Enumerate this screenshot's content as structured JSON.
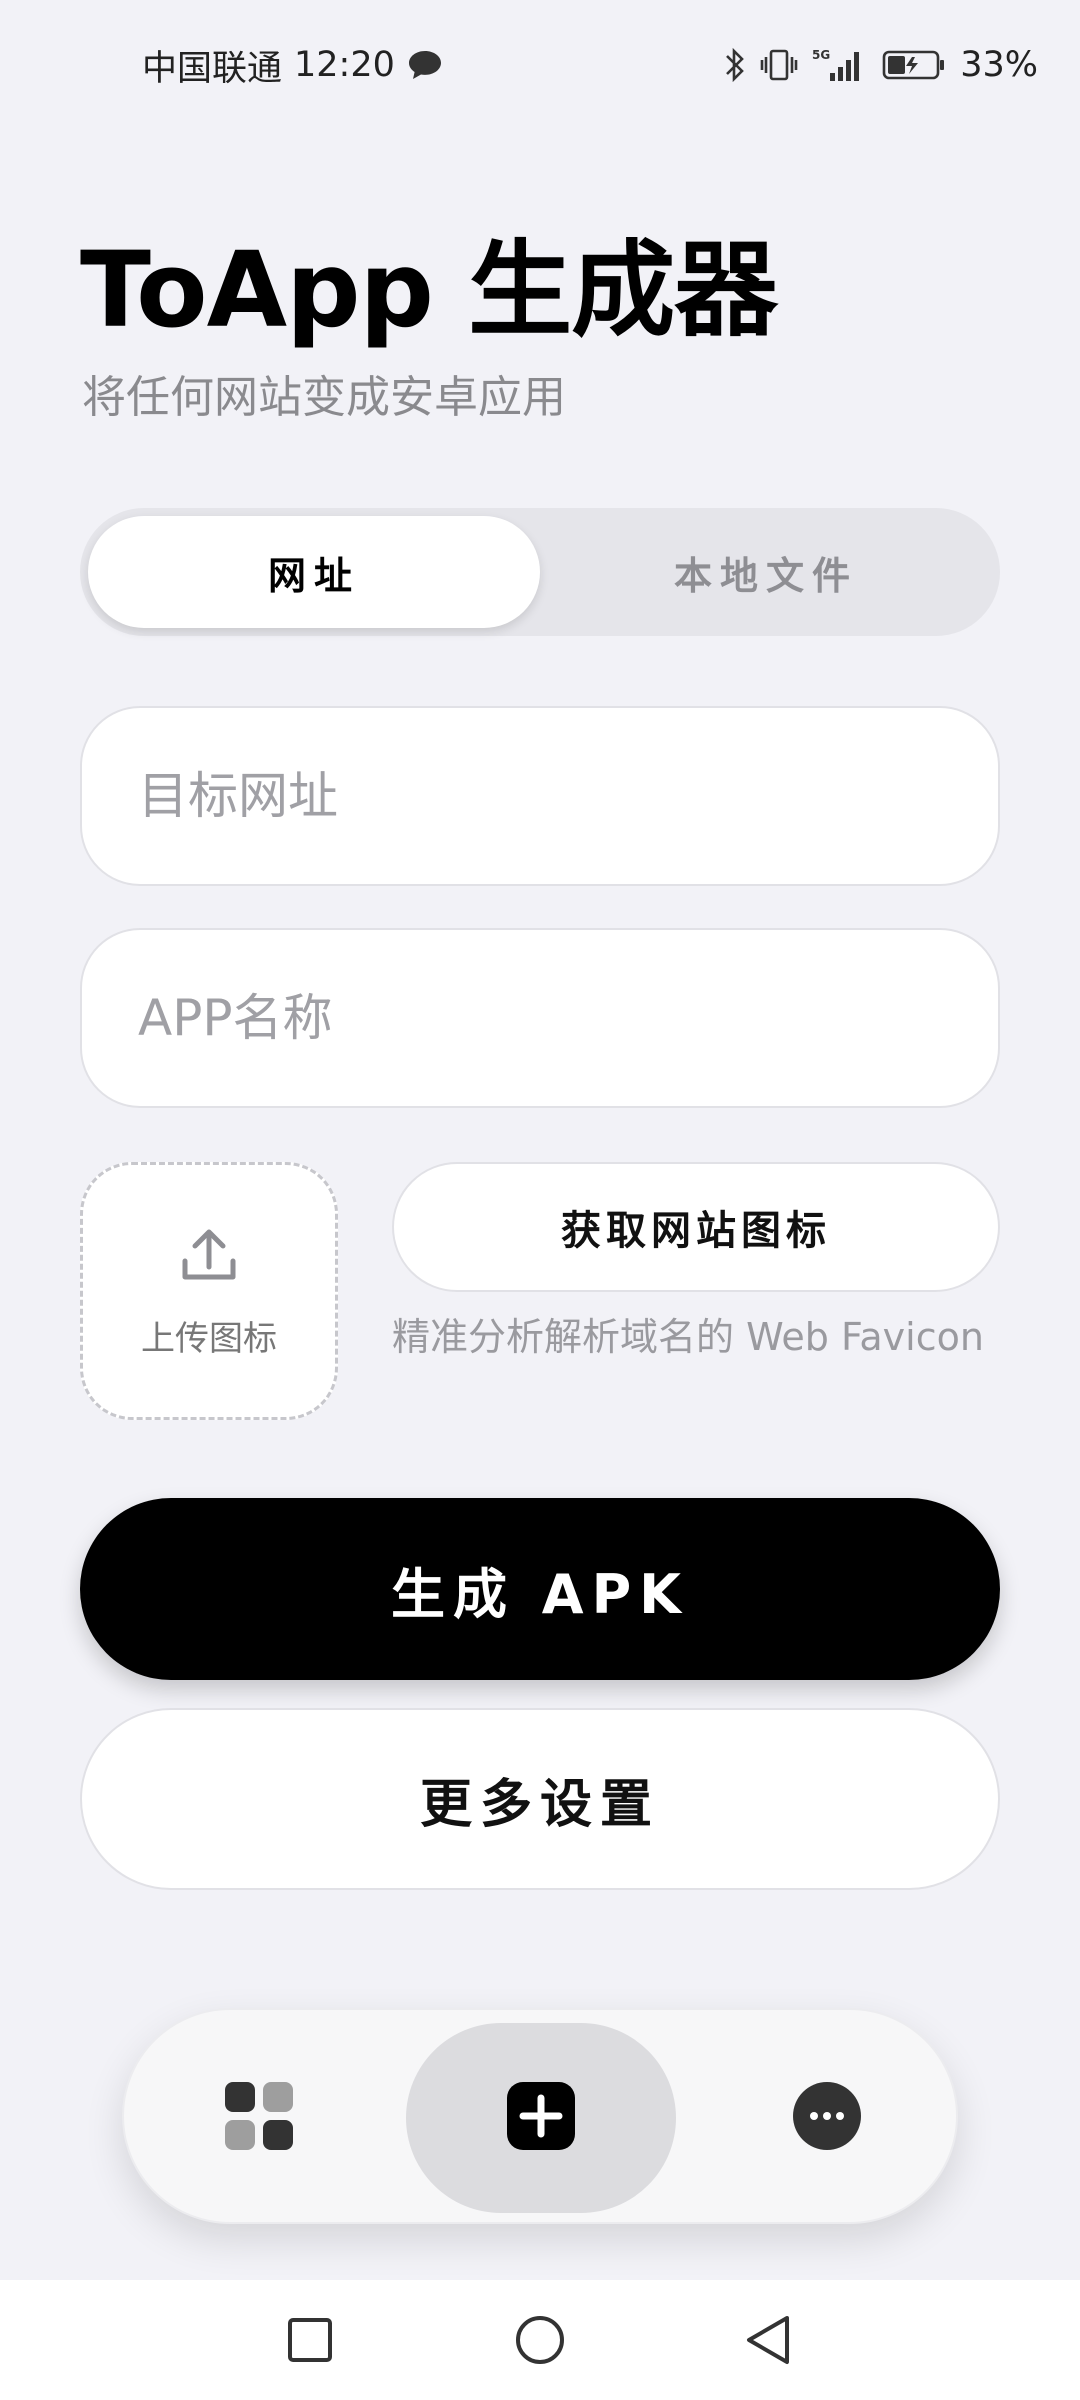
{
  "status_bar": {
    "carrier": "中国联通",
    "time": "12:20",
    "network": "5G",
    "battery": "33%"
  },
  "header": {
    "title": "ToApp 生成器",
    "subtitle": "将任何网站变成安卓应用"
  },
  "tabs": [
    {
      "label": "网址",
      "active": true
    },
    {
      "label": "本地文件",
      "active": false
    }
  ],
  "form": {
    "url_placeholder": "目标网址",
    "url_value": "",
    "app_name_placeholder": "APP名称",
    "app_name_value": ""
  },
  "icon_section": {
    "upload_label": "上传图标",
    "fetch_button": "获取网站图标",
    "fetch_hint": "精准分析解析域名的 Web Favicon"
  },
  "actions": {
    "generate_label": "生成 APK",
    "more_settings_label": "更多设置"
  },
  "bottom_nav": {
    "items": [
      {
        "icon": "apps-grid-icon",
        "active": false
      },
      {
        "icon": "plus-square-icon",
        "active": true
      },
      {
        "icon": "more-dots-icon",
        "active": false
      }
    ]
  },
  "colors": {
    "background": "#f2f2f7",
    "primary": "#000000",
    "muted_text": "#8a8a8e"
  }
}
